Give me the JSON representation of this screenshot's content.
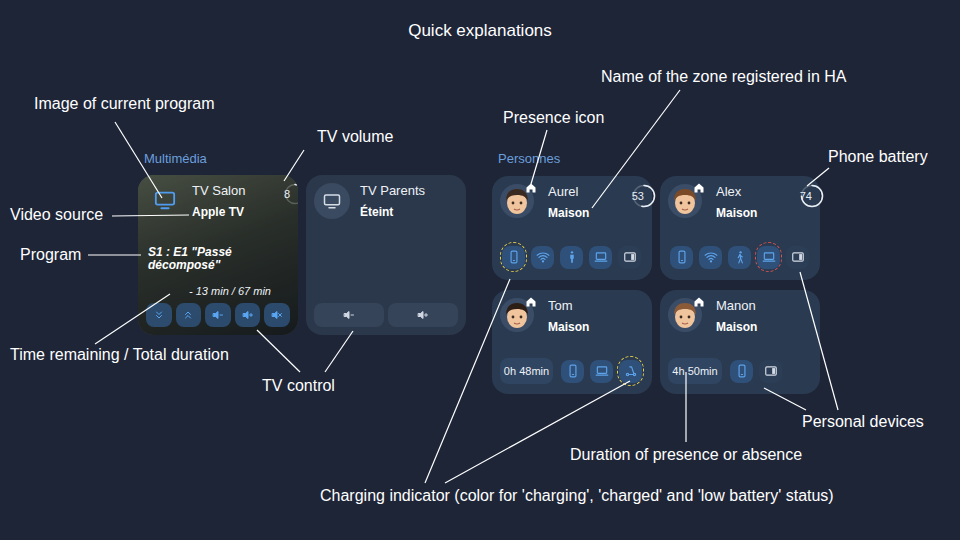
{
  "title": "Quick explanations",
  "multimedia": {
    "label": "Multimédia",
    "tvs": [
      {
        "name": "TV Salon",
        "status": "Apple TV",
        "on": true,
        "volume": "8",
        "volume_level": 0.08,
        "program": "S1 : E1 \"Passé décomposé\"",
        "time": "- 13 min / 67 min",
        "controls": [
          {
            "kind": "channel-down"
          },
          {
            "kind": "channel-up"
          },
          {
            "kind": "volume-down"
          },
          {
            "kind": "volume-up"
          },
          {
            "kind": "mute"
          }
        ]
      },
      {
        "name": "TV Parents",
        "status": "Éteint",
        "on": false,
        "controls": [
          {
            "kind": "volume-down"
          },
          {
            "kind": "volume-up"
          }
        ]
      }
    ]
  },
  "people": {
    "label": "Personnes",
    "persons": [
      {
        "name": "Aurel",
        "zone": "Maison",
        "home": true,
        "battery": "53",
        "battery_level": 0.53,
        "devices": [
          {
            "kind": "phone",
            "active": true,
            "charge": "charging"
          },
          {
            "kind": "wifi",
            "active": true,
            "charge": "none"
          },
          {
            "kind": "person-standing",
            "active": true,
            "charge": "none"
          },
          {
            "kind": "laptop",
            "active": true,
            "charge": "none"
          },
          {
            "kind": "tablet",
            "active": false,
            "charge": "none"
          }
        ]
      },
      {
        "name": "Alex",
        "zone": "Maison",
        "home": true,
        "battery": "74",
        "battery_level": 0.74,
        "devices": [
          {
            "kind": "phone",
            "active": true,
            "charge": "none"
          },
          {
            "kind": "wifi",
            "active": true,
            "charge": "none"
          },
          {
            "kind": "person-walking",
            "active": true,
            "charge": "none"
          },
          {
            "kind": "laptop",
            "active": true,
            "charge": "low"
          },
          {
            "kind": "tablet",
            "active": false,
            "charge": "none"
          }
        ]
      },
      {
        "name": "Tom",
        "zone": "Maison",
        "home": true,
        "duration": "0h 48min",
        "devices": [
          {
            "kind": "phone",
            "active": true,
            "charge": "none"
          },
          {
            "kind": "laptop",
            "active": true,
            "charge": "none"
          },
          {
            "kind": "scooter",
            "active": true,
            "charge": "charging"
          }
        ]
      },
      {
        "name": "Manon",
        "zone": "Maison",
        "home": true,
        "duration": "4h 50min",
        "devices": [
          {
            "kind": "phone",
            "active": true,
            "charge": "none"
          },
          {
            "kind": "tablet",
            "active": false,
            "charge": "none"
          }
        ]
      }
    ]
  },
  "annotations": [
    {
      "text": "Image of current program"
    },
    {
      "text": "TV volume"
    },
    {
      "text": "Video source"
    },
    {
      "text": "Program"
    },
    {
      "text": "Time remaining / Total duration"
    },
    {
      "text": "TV control"
    },
    {
      "text": "Presence icon"
    },
    {
      "text": "Name of the zone registered in HA"
    },
    {
      "text": "Phone battery"
    },
    {
      "text": "Personal devices"
    },
    {
      "text": "Duration of presence or absence"
    },
    {
      "text": "Charging indicator (color for 'charging', 'charged' and 'low battery' status)"
    }
  ]
}
